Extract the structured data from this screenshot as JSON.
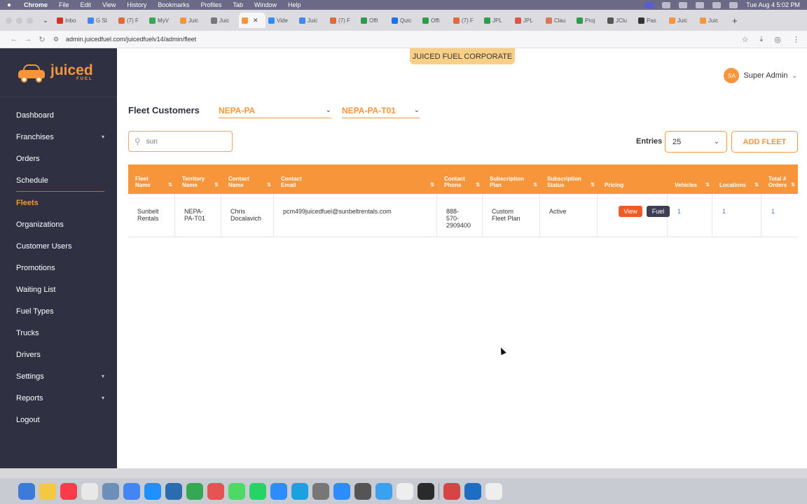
{
  "os_menubar": {
    "app_name": "Chrome",
    "menus": [
      "File",
      "Edit",
      "View",
      "History",
      "Bookmarks",
      "Profiles",
      "Tab",
      "Window",
      "Help"
    ],
    "clock": "Tue Aug 4  5:02 PM"
  },
  "browser": {
    "tabs": [
      {
        "label": "Inbo",
        "color": "#d93025"
      },
      {
        "label": "G St",
        "color": "#4285f4"
      },
      {
        "label": "(7) F",
        "color": "#e06a3a"
      },
      {
        "label": "MyV",
        "color": "#34a853"
      },
      {
        "label": "Juic",
        "color": "#f7953b"
      },
      {
        "label": "Juic",
        "color": "#777777"
      },
      {
        "label": "",
        "color": "#f7953b",
        "active": true
      },
      {
        "label": "Vide",
        "color": "#2d8cff"
      },
      {
        "label": "Juic",
        "color": "#4285f4"
      },
      {
        "label": "(7) F",
        "color": "#e06a3a"
      },
      {
        "label": "Offi",
        "color": "#2e9c4a"
      },
      {
        "label": "Quic",
        "color": "#1a73e8"
      },
      {
        "label": "Offi",
        "color": "#2e9c4a"
      },
      {
        "label": "(7) F",
        "color": "#e06a3a"
      },
      {
        "label": "JPL",
        "color": "#2e9c4a"
      },
      {
        "label": "JPL",
        "color": "#e0524a"
      },
      {
        "label": "Clau",
        "color": "#d97757"
      },
      {
        "label": "Proj",
        "color": "#2e9c4a"
      },
      {
        "label": "JClu",
        "color": "#555555"
      },
      {
        "label": "Pas",
        "color": "#333333"
      },
      {
        "label": "Juic",
        "color": "#f7953b"
      },
      {
        "label": "Juic",
        "color": "#f7953b"
      }
    ],
    "url": "admin.juicedfuel.com/juicedfuelv14/admin/fleet"
  },
  "sidebar": {
    "logo_text": "juiced",
    "logo_sub": "FUEL",
    "items": [
      {
        "label": "Dashboard",
        "chevron": false,
        "active": false
      },
      {
        "label": "Franchises",
        "chevron": true,
        "active": false
      },
      {
        "label": "Orders",
        "chevron": false,
        "active": false
      },
      {
        "label": "Schedule",
        "chevron": false,
        "active": false
      },
      {
        "label": "Fleets",
        "chevron": false,
        "active": true
      },
      {
        "label": "Organizations",
        "chevron": false,
        "active": false
      },
      {
        "label": "Customer Users",
        "chevron": false,
        "active": false
      },
      {
        "label": "Promotions",
        "chevron": false,
        "active": false
      },
      {
        "label": "Waiting List",
        "chevron": false,
        "active": false
      },
      {
        "label": "Fuel Types",
        "chevron": false,
        "active": false
      },
      {
        "label": "Trucks",
        "chevron": false,
        "active": false
      },
      {
        "label": "Drivers",
        "chevron": false,
        "active": false
      },
      {
        "label": "Settings",
        "chevron": true,
        "active": false
      },
      {
        "label": "Reports",
        "chevron": true,
        "active": false
      },
      {
        "label": "Logout",
        "chevron": false,
        "active": false
      }
    ]
  },
  "header": {
    "corporate_badge": "JUICED FUEL CORPORATE",
    "user_initials": "SA",
    "user_name": "Super Admin"
  },
  "main": {
    "title": "Fleet Customers",
    "franchise_select": "NEPA-PA",
    "territory_select": "NEPA-PA-T01",
    "search_placeholder": "sun",
    "entries_label": "Entries",
    "entries_value": "25",
    "add_button": "ADD FLEET"
  },
  "table": {
    "columns": [
      "Fleet\nName",
      "Territory\nName",
      "Contact\nName",
      "Contact Email",
      "Contact\nPhone",
      "Subscription\nPlan",
      "Subscription\nStatus",
      "Pricing",
      "Vehicles",
      "Locations",
      "Total #\nOrders"
    ],
    "rows": [
      {
        "fleet_name": "Sunbelt\nRentals",
        "territory": "NEPA-\nPA-T01",
        "contact_name": "Chris\nDocalavich",
        "email": "pcm499juicedfuel@sunbeltrentals.com",
        "phone": "888-\n570-\n2909400",
        "plan": "Custom\nFleet Plan",
        "status": "Active",
        "view_label": "View",
        "fuel_label": "Fuel",
        "vehicles": "1",
        "locations": "1",
        "orders": "1"
      }
    ]
  },
  "colors": {
    "accent": "#f7953b",
    "sidebar_bg": "#2f3142",
    "view_button": "#f05a28",
    "fuel_button": "#3d3f54",
    "link": "#4a74d6"
  }
}
